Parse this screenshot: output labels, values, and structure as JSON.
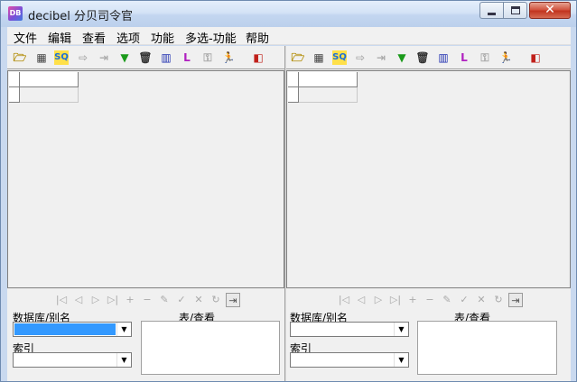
{
  "window": {
    "icon_text": "DB",
    "title": "decibel 分贝司令官"
  },
  "menu": [
    "文件",
    "编辑",
    "查看",
    "选项",
    "功能",
    "多选-功能",
    "帮助"
  ],
  "toolbar": {
    "icons": [
      "open-folder-icon",
      "table-icon",
      "sql-icon",
      "arrow-right-icon",
      "export-icon",
      "filter-icon",
      "trash-icon",
      "insert-row-icon",
      "field-icon",
      "key-search-icon",
      "runner-icon",
      "exit-door-icon"
    ],
    "glyphs": [
      "🗁",
      "▦",
      "SQ",
      "⇨",
      "⇥",
      "▼",
      "🗑",
      "▥",
      "L",
      "⚿",
      "🏃",
      "◧"
    ]
  },
  "navigator": {
    "icons": [
      "first-record-icon",
      "prior-record-icon",
      "next-record-icon",
      "last-record-icon",
      "insert-record-icon",
      "delete-record-icon",
      "edit-record-icon",
      "post-record-icon",
      "cancel-record-icon",
      "refresh-record-icon",
      "apply-icon"
    ],
    "glyphs": [
      "|◁",
      "◁",
      "▷",
      "▷|",
      "+",
      "−",
      "✎",
      "✓",
      "✕",
      "↻",
      "⇥"
    ]
  },
  "panes": [
    {
      "db_label": "数据库/别名",
      "table_label": "表/查看",
      "index_label": "索引",
      "db_value": "",
      "index_value": ""
    },
    {
      "db_label": "数据库/别名",
      "table_label": "表/查看",
      "index_label": "索引",
      "db_value": "",
      "index_value": ""
    }
  ],
  "colors": {
    "selected_combo": "#3399ff",
    "icon_yellow": "#d9b400",
    "icon_green": "#1a9a1a",
    "icon_purple": "#b020c0"
  }
}
